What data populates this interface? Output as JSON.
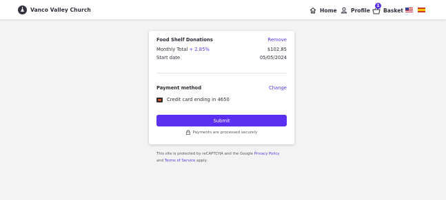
{
  "header": {
    "church_name": "Vanco Valley Church",
    "nav": {
      "home": "Home",
      "profile": "Profile",
      "basket": "Basket",
      "basket_count": "1"
    },
    "languages": [
      "us-flag-icon",
      "es-flag-icon"
    ]
  },
  "donation": {
    "fund_name": "Food Shelf Donations",
    "remove_label": "Remove",
    "frequency_label": "Monthly Total",
    "fee_label": "+ 2.85%",
    "amount": "$102.85",
    "start_date_label": "Start date",
    "start_date": "05/05/2024"
  },
  "payment": {
    "heading": "Payment method",
    "change_label": "Change",
    "card_text": "Credit card ending in 4650"
  },
  "submit_label": "Submit",
  "secure_note": "Payments are processed securely",
  "legal": {
    "prefix": "This site is protected by reCAPTCHA and the Google",
    "privacy_link": "Privacy Policy",
    "and_text": "and",
    "terms_link": "Terms of Service",
    "suffix": "apply."
  },
  "colors": {
    "accent": "#5b34ec",
    "button": "#5b2ff0",
    "background": "#f3f3f4"
  }
}
